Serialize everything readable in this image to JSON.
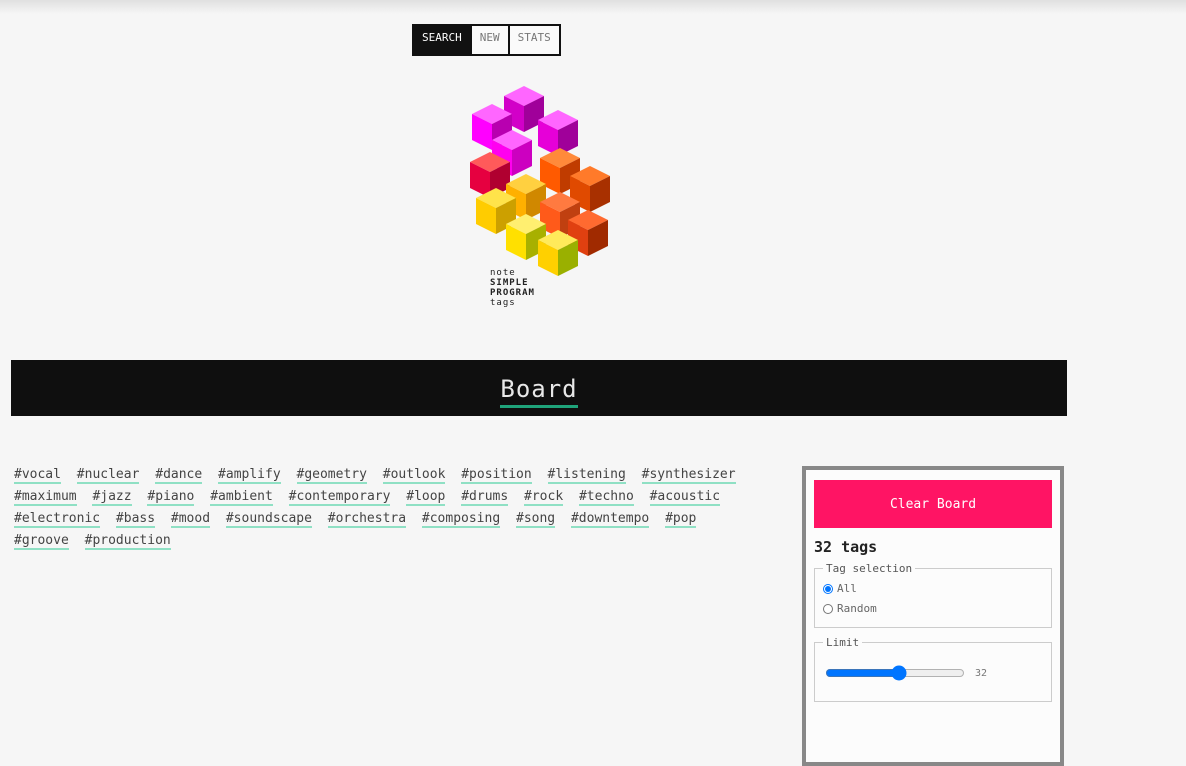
{
  "lang_switch": [
    "SEARCH",
    "NEW",
    "STATS"
  ],
  "logo_caption": [
    "note",
    "SIMPLE",
    "PROGRAM",
    "tags"
  ],
  "page": {
    "title": "Board"
  },
  "tags": [
    "#vocal",
    "#nuclear",
    "#dance",
    "#amplify",
    "#geometry",
    "#outlook",
    "#position",
    "#listening",
    "#synthesizer",
    "#maximum",
    "#jazz",
    "#piano",
    "#ambient",
    "#contemporary",
    "#loop",
    "#drums",
    "#rock",
    "#techno",
    "#acoustic",
    "#electronic",
    "#bass",
    "#mood",
    "#soundscape",
    "#orchestra",
    "#composing",
    "#song",
    "#downtempo",
    "#pop",
    "#groove",
    "#production"
  ],
  "panel": {
    "button_label": "Clear Board",
    "tag_count": "32 tags",
    "selection_legend": "Tag selection",
    "option_all": "All",
    "option_random": "Random",
    "limit_legend": "Limit",
    "limit_value": "32",
    "limit_max": "60"
  },
  "colors": {
    "accent": "#ff1464",
    "bar": "#0f0f0f",
    "underline": "#8fe0c4"
  }
}
